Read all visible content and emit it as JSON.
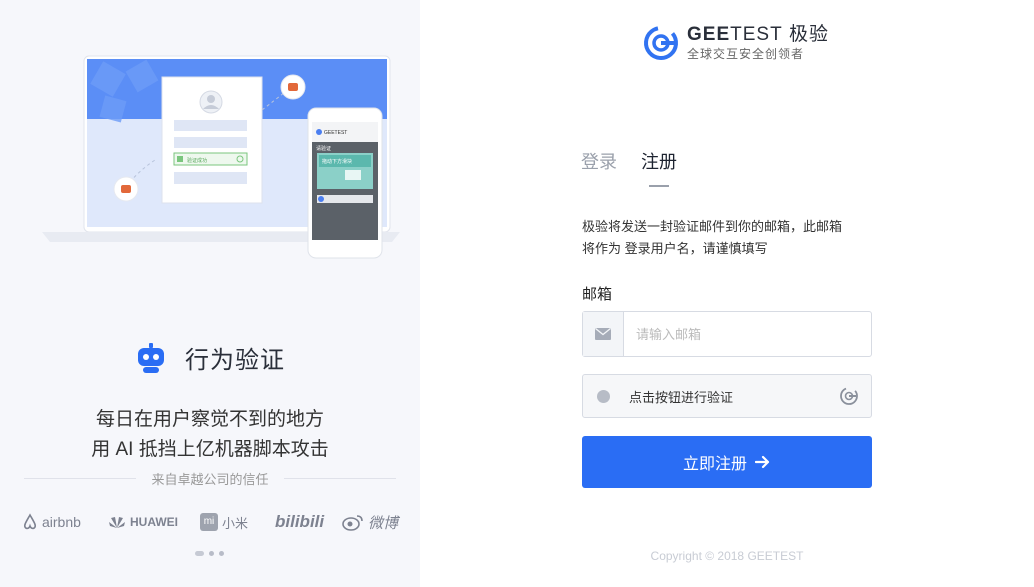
{
  "left": {
    "feature_title": "行为验证",
    "slogan_line1": "每日在用户察觉不到的地方",
    "slogan_line2": "用 AI 抵挡上亿机器脚本攻击",
    "trust_text": "来自卓越公司的信任",
    "logos": [
      "airbnb",
      "HUAWEI",
      "小米",
      "bilibili",
      "微博"
    ],
    "mock": {
      "app_name": "GEETEST",
      "verify_label": "验证成功",
      "mobile_title": "请验证",
      "mobile_banner": "拖动下方滑块"
    }
  },
  "brand": {
    "name_bold": "GEE",
    "name_light": "TEST",
    "name_cn": "极验",
    "tagline": "全球交互安全创领者"
  },
  "tabs": [
    {
      "label": "登录",
      "active": false
    },
    {
      "label": "注册",
      "active": true
    }
  ],
  "form": {
    "desc_line1": "极验将发送一封验证邮件到你的邮箱，此邮箱",
    "desc_line2": "将作为 登录用户名，请谨慎填写",
    "email_label": "邮箱",
    "email_placeholder": "请输入邮箱",
    "email_value": "",
    "captcha_text": "点击按钮进行验证",
    "submit_label": "立即注册"
  },
  "copyright": "Copyright © 2018 GEETEST",
  "colors": {
    "primary": "#2a6df4",
    "left_bg": "#f6f7fb",
    "illustration_blue": "#5b8ef6"
  },
  "icons": [
    "robot-icon",
    "mail-icon",
    "geetest-logo-icon",
    "arrow-right-icon",
    "user-avatar-icon",
    "check-icon"
  ]
}
